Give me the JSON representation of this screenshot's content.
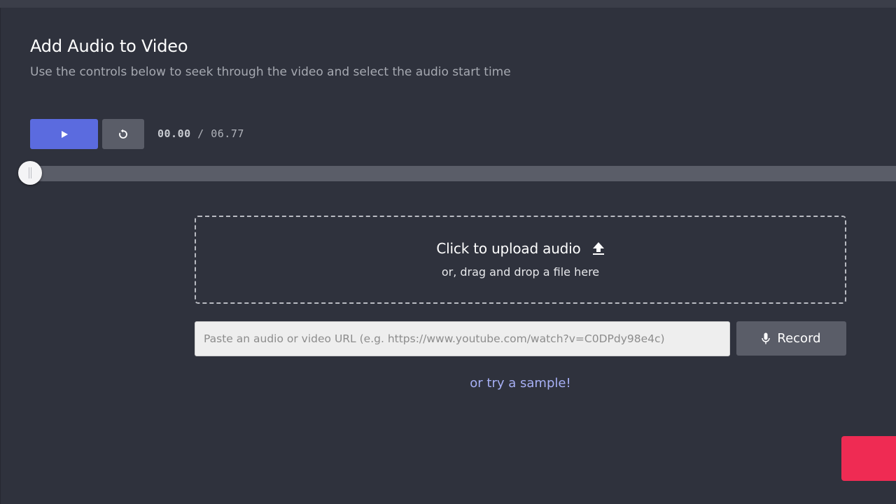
{
  "header": {
    "title": "Add Audio to Video",
    "subtitle": "Use the controls below to seek through the video and select the audio start time"
  },
  "player": {
    "play_icon": "play-icon",
    "restart_icon": "restart-icon",
    "current_time": "00.00",
    "separator": " / ",
    "duration": "06.77",
    "seek_progress": 0
  },
  "upload": {
    "title": "Click to upload audio",
    "icon": "upload-icon",
    "subtitle": "or, drag and drop a file here"
  },
  "url_input": {
    "placeholder": "Paste an audio or video URL (e.g. https://www.youtube.com/watch?v=C0DPdy98e4c)",
    "value": ""
  },
  "record": {
    "label": "Record",
    "icon": "microphone-icon"
  },
  "sample": {
    "label": "or try a sample!"
  },
  "colors": {
    "background": "#2f323d",
    "accent": "#5b6bdf",
    "secondary_button": "#5a5d68",
    "link": "#a7b0f5",
    "fab": "#ef2b53"
  }
}
